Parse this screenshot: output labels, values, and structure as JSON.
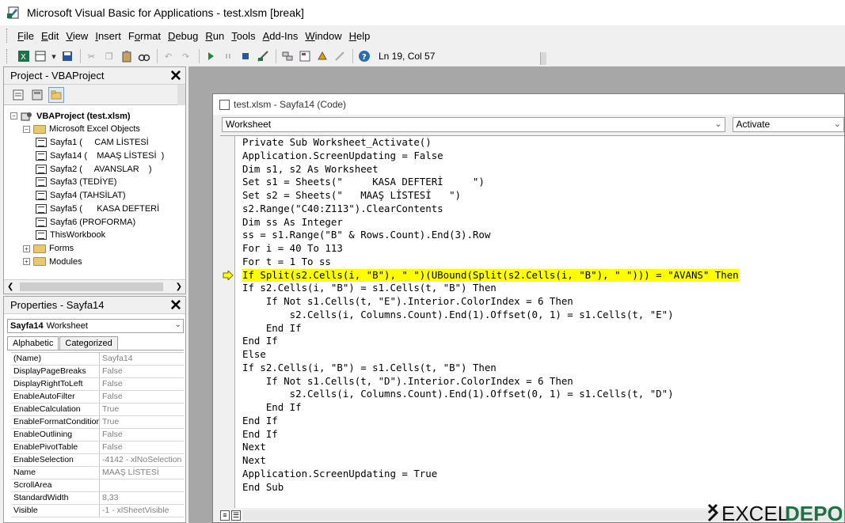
{
  "window": {
    "title": "Microsoft Visual Basic for Applications - test.xlsm [break]"
  },
  "menu": [
    {
      "label": "File",
      "key": "F"
    },
    {
      "label": "Edit",
      "key": "E"
    },
    {
      "label": "View",
      "key": "V"
    },
    {
      "label": "Insert",
      "key": "I"
    },
    {
      "label": "Format",
      "key": "o"
    },
    {
      "label": "Debug",
      "key": "D"
    },
    {
      "label": "Run",
      "key": "R"
    },
    {
      "label": "Tools",
      "key": "T"
    },
    {
      "label": "Add-Ins",
      "key": "A"
    },
    {
      "label": "Window",
      "key": "W"
    },
    {
      "label": "Help",
      "key": "H"
    }
  ],
  "toolbar": {
    "status": "Ln 19, Col 57",
    "buttons": [
      "excel-icon",
      "insert-module-icon",
      "save-icon",
      "cut-icon",
      "copy-icon",
      "paste-icon",
      "find-icon",
      "undo-icon",
      "redo-icon",
      "run-icon",
      "break-icon",
      "reset-icon",
      "design-mode-icon",
      "project-explorer-icon",
      "properties-icon",
      "object-browser-icon",
      "toolbox-icon",
      "help-icon"
    ]
  },
  "project": {
    "title": "Project - VBAProject",
    "root": "VBAProject (test.xlsm)",
    "objects_folder": "Microsoft Excel Objects",
    "items": [
      "Sayfa1 (     CAM LİSTESİ",
      "Sayfa14 (    MAAŞ LİSTESİ  )",
      "Sayfa2 (     AVANSLAR    )",
      "Sayfa3 (TEDİYE)",
      "Sayfa4 (TAHSİLAT)",
      "Sayfa5 (      KASA DEFTERİ",
      "Sayfa6 (PROFORMA)",
      "ThisWorkbook"
    ],
    "folders": [
      "Forms",
      "Modules"
    ]
  },
  "properties": {
    "title": "Properties - Sayfa14",
    "object_name": "Sayfa14",
    "object_type": "Worksheet",
    "tabs": [
      "Alphabetic",
      "Categorized"
    ],
    "rows": [
      {
        "name": "(Name)",
        "value": "Sayfa14"
      },
      {
        "name": "DisplayPageBreaks",
        "value": "False"
      },
      {
        "name": "DisplayRightToLeft",
        "value": "False"
      },
      {
        "name": "EnableAutoFilter",
        "value": "False"
      },
      {
        "name": "EnableCalculation",
        "value": "True"
      },
      {
        "name": "EnableFormatConditions",
        "value": "True"
      },
      {
        "name": "EnableOutlining",
        "value": "False"
      },
      {
        "name": "EnablePivotTable",
        "value": "False"
      },
      {
        "name": "EnableSelection",
        "value": "-4142 - xlNoSelection"
      },
      {
        "name": "Name",
        "value": "     MAAŞ LİSTESİ"
      },
      {
        "name": "ScrollArea",
        "value": ""
      },
      {
        "name": "StandardWidth",
        "value": "8,33"
      },
      {
        "name": "Visible",
        "value": "-1 - xlSheetVisible"
      }
    ]
  },
  "code_window": {
    "title": "test.xlsm - Sayfa14 (Code)",
    "object_combo": "Worksheet",
    "procedure_combo": "Activate",
    "current_line_index": 10,
    "lines": [
      "Private Sub Worksheet_Activate()",
      "Application.ScreenUpdating = False",
      "Dim s1, s2 As Worksheet",
      "Set s1 = Sheets(\"     KASA DEFTERİ     \")",
      "Set s2 = Sheets(\"   MAAŞ LİSTESİ   \")",
      "s2.Range(\"C40:Z113\").ClearContents",
      "Dim ss As Integer",
      "ss = s1.Range(\"B\" & Rows.Count).End(3).Row",
      "For i = 40 To 113",
      "For t = 1 To ss",
      "If Split(s2.Cells(i, \"B\"), \" \")(UBound(Split(s2.Cells(i, \"B\"), \" \"))) = \"AVANS\" Then",
      "If s2.Cells(i, \"B\") = s1.Cells(t, \"B\") Then",
      "    If Not s1.Cells(t, \"E\").Interior.ColorIndex = 6 Then",
      "        s2.Cells(i, Columns.Count).End(1).Offset(0, 1) = s1.Cells(t, \"E\")",
      "    End If",
      "End If",
      "Else",
      "If s2.Cells(i, \"B\") = s1.Cells(t, \"B\") Then",
      "    If Not s1.Cells(t, \"D\").Interior.ColorIndex = 6 Then",
      "        s2.Cells(i, Columns.Count).End(1).Offset(0, 1) = s1.Cells(t, \"D\")",
      "    End If",
      "End If",
      "End If",
      "Next",
      "Next",
      "Application.ScreenUpdating = True",
      "End Sub"
    ]
  },
  "watermark": "EXCEL DEPO",
  "colors": {
    "highlight": "#ffff00",
    "mdi_bg": "#a7a7a7"
  }
}
